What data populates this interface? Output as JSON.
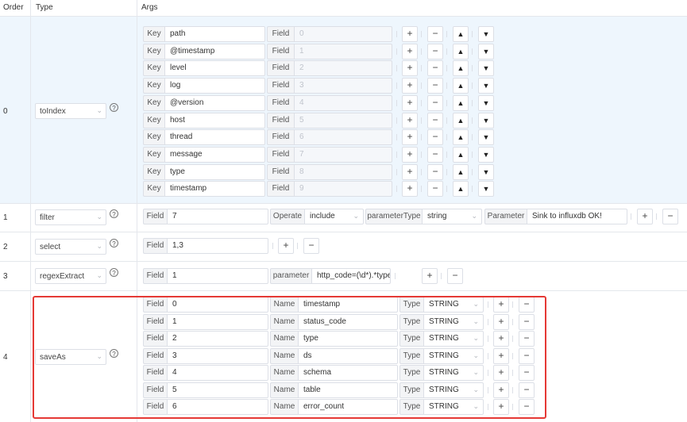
{
  "header": {
    "order": "Order",
    "type": "Type",
    "args": "Args"
  },
  "labels": {
    "key": "Key",
    "field": "Field",
    "name": "Name",
    "type": "Type",
    "operate": "Operate",
    "parameterType": "parameterType",
    "parameter": "Parameter",
    "parameter_lower": "parameter"
  },
  "buttons": {
    "plus": "+",
    "minus": "−",
    "up": "▲",
    "down": "▼",
    "help": "?"
  },
  "colors": {
    "highlight_bg": "#eef6fd",
    "border": "#dcdfe6",
    "annotation": "#e53935"
  },
  "steps": [
    {
      "order": "0",
      "type": "toIndex",
      "rows": [
        {
          "key": "path",
          "field": "0"
        },
        {
          "key": "@timestamp",
          "field": "1"
        },
        {
          "key": "level",
          "field": "2"
        },
        {
          "key": "log",
          "field": "3"
        },
        {
          "key": "@version",
          "field": "4"
        },
        {
          "key": "host",
          "field": "5"
        },
        {
          "key": "thread",
          "field": "6"
        },
        {
          "key": "message",
          "field": "7"
        },
        {
          "key": "type",
          "field": "8"
        },
        {
          "key": "timestamp",
          "field": "9"
        }
      ]
    },
    {
      "order": "1",
      "type": "filter",
      "field": "7",
      "operate": "include",
      "parameterType": "string",
      "parameter": "Sink to influxdb OK!"
    },
    {
      "order": "2",
      "type": "select",
      "field": "1,3"
    },
    {
      "order": "3",
      "type": "regexExtract",
      "field": "1",
      "parameter": "http_code=(\\d*).*type=(.*),d"
    },
    {
      "order": "4",
      "type": "saveAs",
      "rows": [
        {
          "field": "0",
          "name": "timestamp",
          "type": "STRING"
        },
        {
          "field": "1",
          "name": "status_code",
          "type": "STRING"
        },
        {
          "field": "2",
          "name": "type",
          "type": "STRING"
        },
        {
          "field": "3",
          "name": "ds",
          "type": "STRING"
        },
        {
          "field": "4",
          "name": "schema",
          "type": "STRING"
        },
        {
          "field": "5",
          "name": "table",
          "type": "STRING"
        },
        {
          "field": "6",
          "name": "error_count",
          "type": "STRING"
        }
      ]
    }
  ]
}
